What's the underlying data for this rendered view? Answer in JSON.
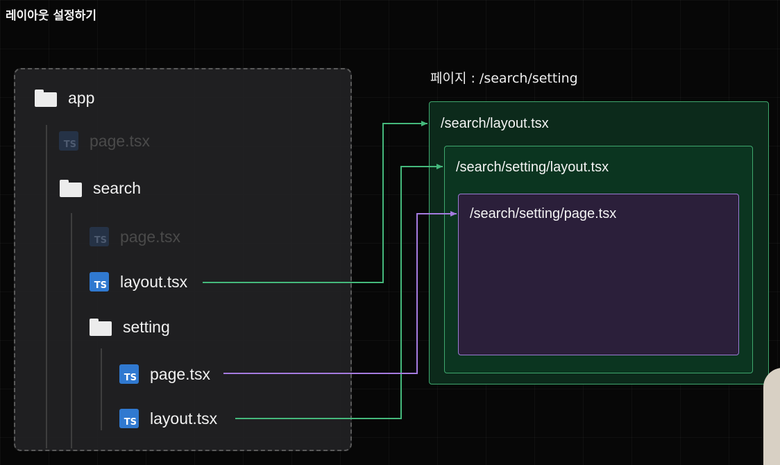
{
  "header": {
    "title": "레이아웃 설정하기"
  },
  "tree": {
    "app": "app",
    "app_page": "page.tsx",
    "search": "search",
    "search_page": "page.tsx",
    "search_layout": "layout.tsx",
    "setting": "setting",
    "setting_page": "page.tsx",
    "setting_layout": "layout.tsx",
    "ts_badge": "TS"
  },
  "preview": {
    "caption": "페이지 : /search/setting",
    "outer_label": "/search/layout.tsx",
    "middle_label": "/search/setting/layout.tsx",
    "inner_label": "/search/setting/page.tsx"
  },
  "colors": {
    "layout_arrow": "#45b97c",
    "page_arrow": "#a57be0",
    "ts_blue": "#3079d0"
  }
}
